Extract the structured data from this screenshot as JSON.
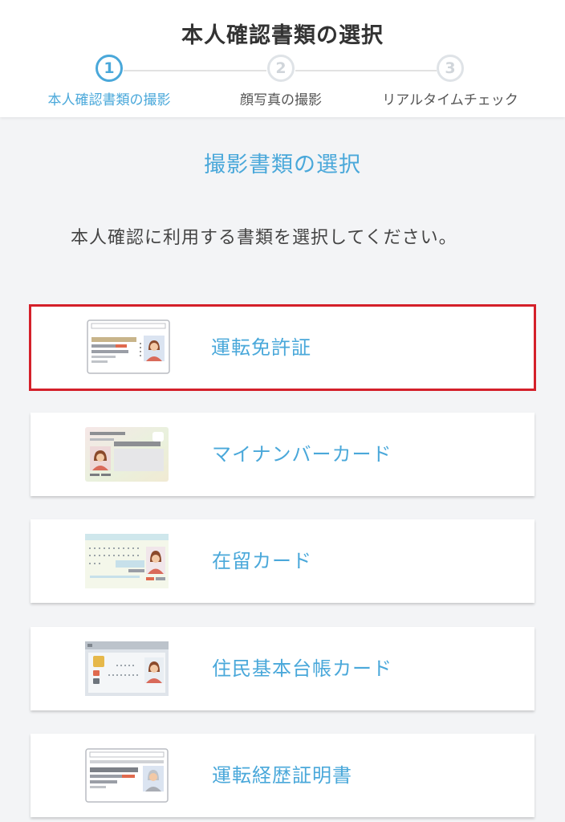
{
  "header": {
    "title": "本人確認書類の選択",
    "steps": [
      {
        "number": "1",
        "label": "本人確認書類の撮影",
        "active": true
      },
      {
        "number": "2",
        "label": "顔写真の撮影",
        "active": false
      },
      {
        "number": "3",
        "label": "リアルタイムチェック",
        "active": false
      }
    ]
  },
  "main": {
    "section_title": "撮影書類の選択",
    "instruction": "本人確認に利用する書類を選択してください。",
    "documents": [
      {
        "label": "運転免許証",
        "icon": "drivers-license-icon",
        "selected": true
      },
      {
        "label": "マイナンバーカード",
        "icon": "my-number-card-icon",
        "selected": false
      },
      {
        "label": "在留カード",
        "icon": "residence-card-icon",
        "selected": false
      },
      {
        "label": "住民基本台帳カード",
        "icon": "resident-registry-card-icon",
        "selected": false
      },
      {
        "label": "運転経歴証明書",
        "icon": "driving-history-certificate-icon",
        "selected": false
      }
    ]
  },
  "colors": {
    "accent": "#4aa8da",
    "selected_border": "#d4202a",
    "background": "#f3f4f6"
  }
}
